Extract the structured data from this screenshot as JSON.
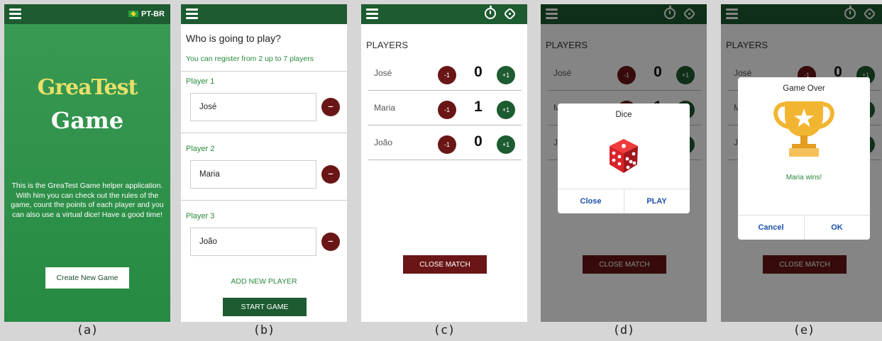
{
  "language": "PT-BR",
  "captions": [
    "(a)",
    "(b)",
    "(c)",
    "(d)",
    "(e)"
  ],
  "screen_a": {
    "logo_top": "GreaTest",
    "logo_bottom": "Game",
    "intro": "This is the GreaTest Game helper application. With him you can check out the rules of the game, count the points of each player and you can also use a virtual dice! Have a good time!",
    "create_button": "Create New Game"
  },
  "screen_b": {
    "title": "Who is going to play?",
    "subtitle": "You can register from 2 up to 7 players",
    "players": [
      {
        "label": "Player 1",
        "value": "José"
      },
      {
        "label": "Player 2",
        "value": "Maria"
      },
      {
        "label": "Player 3",
        "value": "João"
      }
    ],
    "remove_symbol": "–",
    "add_player": "ADD NEW PLAYER",
    "start_button": "START GAME"
  },
  "scoreboard": {
    "heading": "PLAYERS",
    "minus_label": "-1",
    "plus_label": "+1",
    "rows": [
      {
        "name": "José",
        "score": "0"
      },
      {
        "name": "Maria",
        "score": "1"
      },
      {
        "name": "João",
        "score": "0"
      }
    ],
    "close_match": "CLOSE MATCH"
  },
  "dice_dialog": {
    "title": "Dice",
    "close": "Close",
    "play": "PLAY"
  },
  "gameover_dialog": {
    "title": "Game Over",
    "message": "Maria wins!",
    "cancel": "Cancel",
    "ok": "OK"
  },
  "colors": {
    "primary_green": "#1d5b30",
    "accent_green": "#2a8a3d",
    "dark_red": "#6a1616",
    "link_blue": "#1a4fa8",
    "dice_red": "#d8222a",
    "trophy_gold": "#f2b531"
  }
}
